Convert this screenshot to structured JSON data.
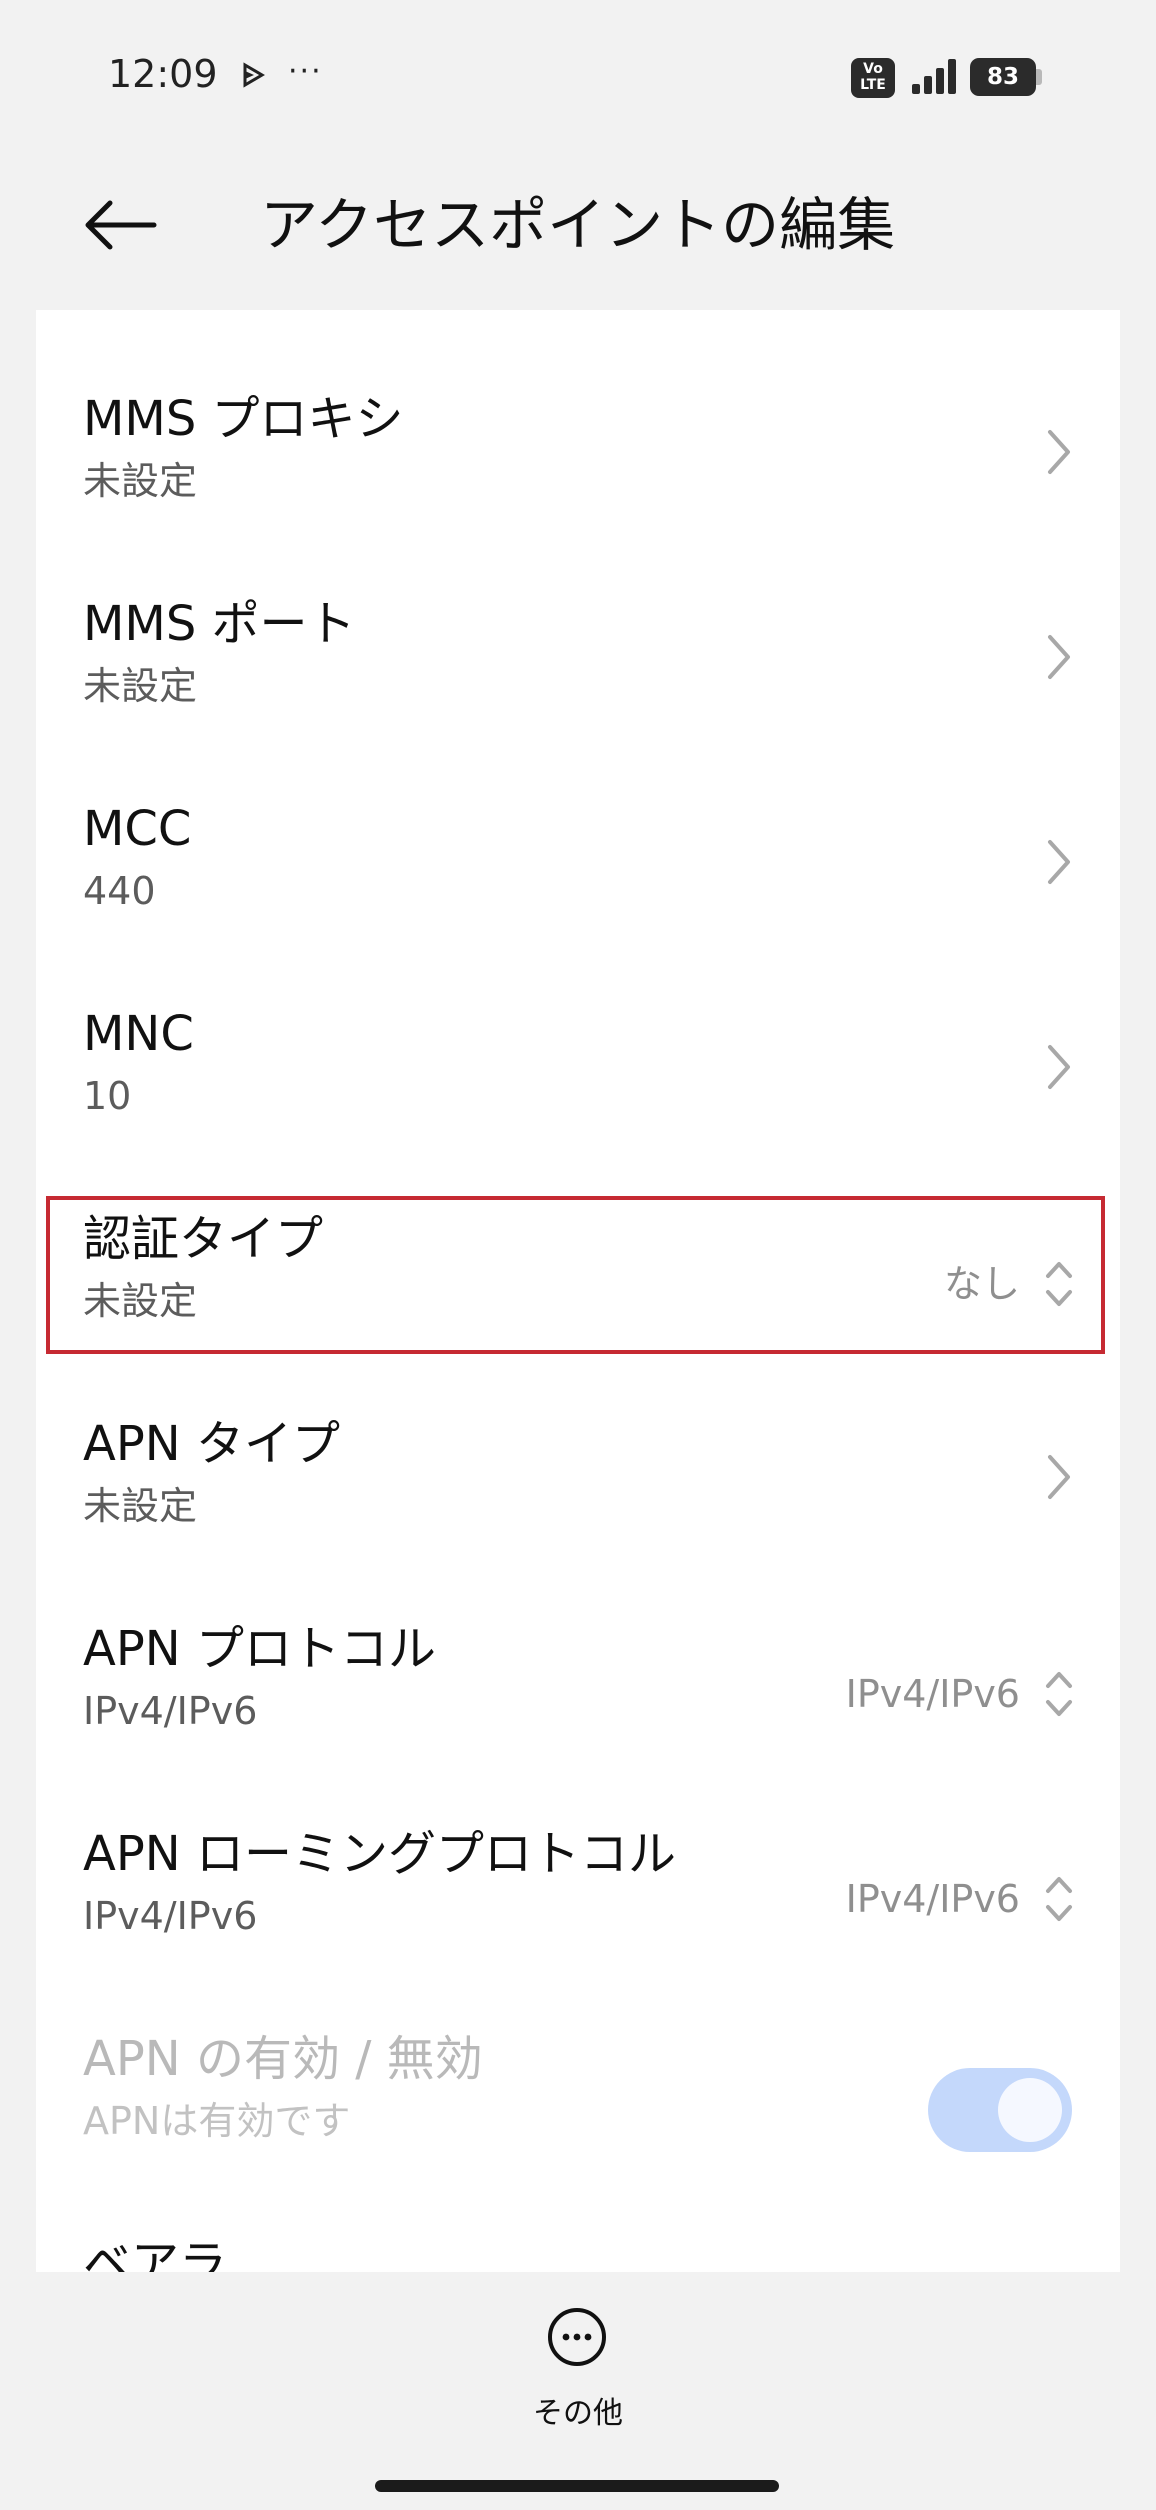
{
  "status_bar": {
    "time": "12:09",
    "more": "···",
    "volte": "Vo\nLTE",
    "battery": "83"
  },
  "header": {
    "title": "アクセスポイントの編集"
  },
  "settings": [
    {
      "title": "MMS プロキシ",
      "subtitle": "未設定",
      "control": "chevron"
    },
    {
      "title": "MMS ポート",
      "subtitle": "未設定",
      "control": "chevron"
    },
    {
      "title": "MCC",
      "subtitle": "440",
      "control": "chevron"
    },
    {
      "title": "MNC",
      "subtitle": "10",
      "control": "chevron"
    },
    {
      "title": "認証タイプ",
      "subtitle": "未設定",
      "value": "なし",
      "control": "select",
      "highlighted": true
    },
    {
      "title": "APN タイプ",
      "subtitle": "未設定",
      "control": "chevron"
    },
    {
      "title": "APN プロトコル",
      "subtitle": "IPv4/IPv6",
      "value": "IPv4/IPv6",
      "control": "select"
    },
    {
      "title": "APN ローミングプロトコル",
      "subtitle": "IPv4/IPv6",
      "value": "IPv4/IPv6",
      "control": "select"
    },
    {
      "title": "APN の有効 / 無効",
      "subtitle": "APNは有効です",
      "control": "toggle",
      "toggle_on": true,
      "disabled": true
    },
    {
      "title": "ベアラ",
      "subtitle": "",
      "control": "none"
    }
  ],
  "bottom_bar": {
    "more_label": "その他"
  },
  "colors": {
    "highlight": "#c62a32",
    "toggle_track": "#c4d8fb",
    "background": "#f2f2f2"
  }
}
